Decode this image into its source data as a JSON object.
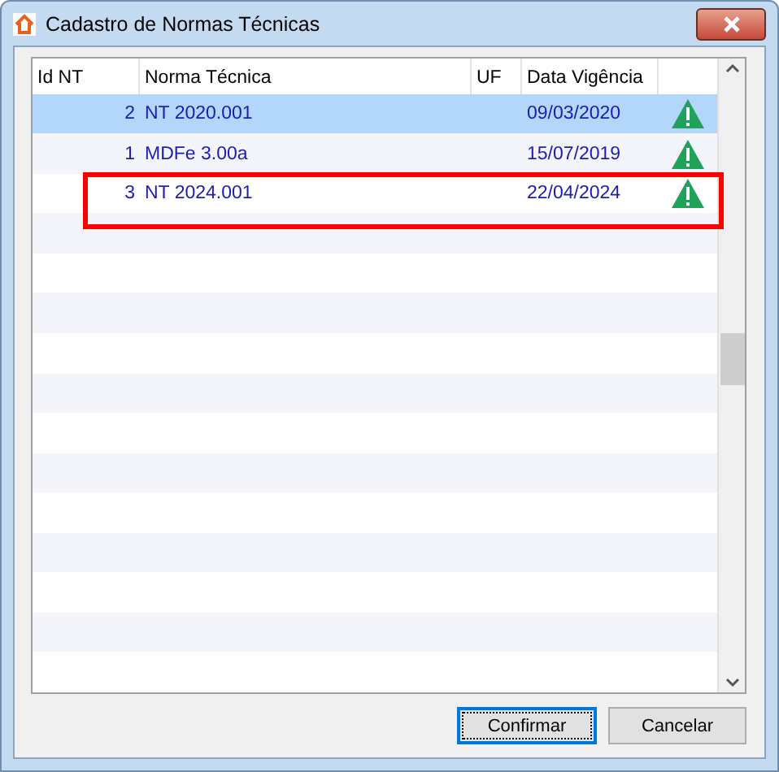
{
  "window": {
    "title": "Cadastro de Normas Técnicas"
  },
  "table": {
    "columns": [
      "Id NT",
      "Norma Técnica",
      "UF",
      "Data Vigência"
    ],
    "rows": [
      {
        "id": "2",
        "norma": "NT 2020.001",
        "data": "09/03/2020",
        "selected": true,
        "highlighted": false
      },
      {
        "id": "1",
        "norma": "MDFe 3.00a",
        "data": "15/07/2019",
        "selected": false,
        "highlighted": false
      },
      {
        "id": "3",
        "norma": "NT 2024.001",
        "data": "22/04/2024",
        "selected": false,
        "highlighted": true
      }
    ]
  },
  "buttons": [
    {
      "label": "Confirmar",
      "default": true
    },
    {
      "label": "Cancelar",
      "default": false
    }
  ]
}
